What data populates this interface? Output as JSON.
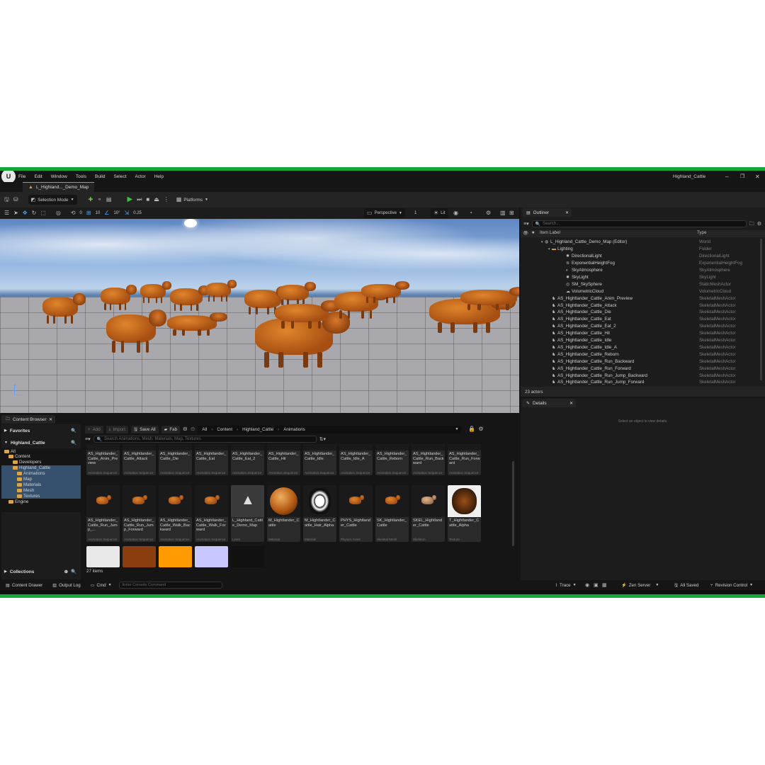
{
  "window": {
    "title": "Highland_Cattle",
    "tab": "L_Highland..._Demo_Map"
  },
  "menu": [
    "File",
    "Edit",
    "Window",
    "Tools",
    "Build",
    "Select",
    "Actor",
    "Help"
  ],
  "toolbar": {
    "mode": "Selection Mode",
    "platforms": "Platforms"
  },
  "viewport": {
    "snap_translate": "10",
    "snap_rotate": "10°",
    "snap_scale": "0.25",
    "snap_unknown": "0",
    "view_mode": "Perspective",
    "lit": "Lit",
    "cam_speed": "1"
  },
  "outliner": {
    "title": "Outliner",
    "search_placeholder": "Search...",
    "col_label": "Item Label",
    "col_type": "Type",
    "count": "23 actors",
    "rows": [
      {
        "label": "L_Highland_Cattle_Demo_Map (Editor)",
        "type": "World",
        "indent": 0,
        "icon": "world"
      },
      {
        "label": "Lighting",
        "type": "Folder",
        "indent": 1,
        "icon": "folder"
      },
      {
        "label": "DirectionalLight",
        "type": "DirectionalLight",
        "indent": 2,
        "icon": "light"
      },
      {
        "label": "ExponentialHeightFog",
        "type": "ExponentialHeightFog",
        "indent": 2,
        "icon": "fog"
      },
      {
        "label": "SkyAtmosphere",
        "type": "SkyAtmosphere",
        "indent": 2,
        "icon": "sky"
      },
      {
        "label": "SkyLight",
        "type": "SkyLight",
        "indent": 2,
        "icon": "light"
      },
      {
        "label": "SM_SkySphere",
        "type": "StaticMeshActor",
        "indent": 2,
        "icon": "mesh"
      },
      {
        "label": "VolumetricCloud",
        "type": "VolumetricCloud",
        "indent": 2,
        "icon": "cloud"
      },
      {
        "label": "AS_Hightlander_Cattle_Anim_Preview",
        "type": "SkeletalMeshActor",
        "indent": 1,
        "icon": "skel"
      },
      {
        "label": "AS_Hightlander_Cattle_Attack",
        "type": "SkeletalMeshActor",
        "indent": 1,
        "icon": "skel"
      },
      {
        "label": "AS_Hightlander_Cattle_Die",
        "type": "SkeletalMeshActor",
        "indent": 1,
        "icon": "skel"
      },
      {
        "label": "AS_Hightlander_Cattle_Eat",
        "type": "SkeletalMeshActor",
        "indent": 1,
        "icon": "skel"
      },
      {
        "label": "AS_Hightlander_Cattle_Eat_2",
        "type": "SkeletalMeshActor",
        "indent": 1,
        "icon": "skel"
      },
      {
        "label": "AS_Hightlander_Cattle_Hit",
        "type": "SkeletalMeshActor",
        "indent": 1,
        "icon": "skel"
      },
      {
        "label": "AS_Hightlander_Cattle_Idle",
        "type": "SkeletalMeshActor",
        "indent": 1,
        "icon": "skel"
      },
      {
        "label": "AS_Hightlander_Cattle_Idle_A",
        "type": "SkeletalMeshActor",
        "indent": 1,
        "icon": "skel"
      },
      {
        "label": "AS_Hightlander_Cattle_Reborn",
        "type": "SkeletalMeshActor",
        "indent": 1,
        "icon": "skel"
      },
      {
        "label": "AS_Hightlander_Cattle_Run_Backward",
        "type": "SkeletalMeshActor",
        "indent": 1,
        "icon": "skel"
      },
      {
        "label": "AS_Hightlander_Cattle_Run_Forward",
        "type": "SkeletalMeshActor",
        "indent": 1,
        "icon": "skel"
      },
      {
        "label": "AS_Hightlander_Cattle_Run_Jump_Backward",
        "type": "SkeletalMeshActor",
        "indent": 1,
        "icon": "skel"
      },
      {
        "label": "AS_Hightlander_Cattle_Run_Jump_Forward",
        "type": "SkeletalMeshActor",
        "indent": 1,
        "icon": "skel"
      }
    ]
  },
  "details": {
    "title": "Details",
    "empty": "Select an object to view details."
  },
  "content_browser": {
    "title": "Content Browser",
    "add": "Add",
    "import": "Import",
    "save_all": "Save All",
    "fab": "Fab",
    "breadcrumb": [
      "All",
      "Content",
      "Highland_Cattle",
      "Animations"
    ],
    "search_placeholder": "Search Animations, Mesh, Materials, Map, Textures",
    "favorites": "Favorites",
    "project": "Highland_Cattle",
    "collections": "Collections",
    "count": "27 items",
    "tree": [
      {
        "label": "All",
        "indent": 0,
        "sel": false
      },
      {
        "label": "Content",
        "indent": 1,
        "sel": false
      },
      {
        "label": "Developers",
        "indent": 2,
        "sel": false
      },
      {
        "label": "Highland_Cattle",
        "indent": 2,
        "sel": true
      },
      {
        "label": "Animations",
        "indent": 3,
        "sel": true
      },
      {
        "label": "Map",
        "indent": 3,
        "sel": true
      },
      {
        "label": "Materials",
        "indent": 3,
        "sel": true
      },
      {
        "label": "Mesh",
        "indent": 3,
        "sel": true
      },
      {
        "label": "Textures",
        "indent": 3,
        "sel": true
      },
      {
        "label": "Engine",
        "indent": 1,
        "sel": false
      }
    ],
    "row1": [
      {
        "name": "AS_Hightlander_Cattle_Anim_Preview",
        "kind": "Animation Sequence"
      },
      {
        "name": "AS_Hightlander_Cattle_Attack",
        "kind": "Animation Sequence"
      },
      {
        "name": "AS_Hightlander_Cattle_Die",
        "kind": "Animation Sequence"
      },
      {
        "name": "AS_Hightlander_Cattle_Eat",
        "kind": "Animation Sequence"
      },
      {
        "name": "AS_Hightlander_Cattle_Eat_2",
        "kind": "Animation Sequence"
      },
      {
        "name": "AS_Hightlander_Cattle_Hit",
        "kind": "Animation Sequence"
      },
      {
        "name": "AS_Hightlander_Cattle_Idle",
        "kind": "Animation Sequence"
      },
      {
        "name": "AS_Hightlander_Cattle_Idle_A",
        "kind": "Animation Sequence"
      },
      {
        "name": "AS_Hightlander_Cattle_Reborn",
        "kind": "Animation Sequence"
      },
      {
        "name": "AS_Hightlander_Cattle_Run_Backward",
        "kind": "Animation Sequence"
      },
      {
        "name": "AS_Hightlander_Cattle_Run_Forward",
        "kind": "Animation Sequence"
      }
    ],
    "row2": [
      {
        "name": "AS_Hightlander_Cattle_Run_Jump_...",
        "kind": "Animation Sequence",
        "thumb": "cow"
      },
      {
        "name": "AS_Hightlander_Cattle_Run_Jump_Forward",
        "kind": "Animation Sequence",
        "thumb": "cow"
      },
      {
        "name": "AS_Hightlander_Cattle_Walk_Backward",
        "kind": "Animation Sequence",
        "thumb": "cow"
      },
      {
        "name": "AS_Hightlander_Cattle_Walk_Forward",
        "kind": "Animation Sequence",
        "thumb": "cow"
      },
      {
        "name": "L_Highland_Cattle_Demo_Map",
        "kind": "Level",
        "thumb": "level"
      },
      {
        "name": "M_Hightlander_Cattle",
        "kind": "Material",
        "thumb": "sphere"
      },
      {
        "name": "M_Hightlander_Cattle_Hair_Alpha",
        "kind": "Material",
        "thumb": "alpha"
      },
      {
        "name": "PHYS_Hightlander_Cattle",
        "kind": "Physics Asset",
        "thumb": "cow"
      },
      {
        "name": "SK_Hightlander_Cattle",
        "kind": "Skeletal Mesh",
        "thumb": "cow"
      },
      {
        "name": "SKEL_Hightlander_Cattle",
        "kind": "Skeleton",
        "thumb": "skel"
      },
      {
        "name": "T_Hightlander_Cattle_Alpha",
        "kind": "Texture",
        "thumb": "tex"
      }
    ]
  },
  "statusbar": {
    "drawer": "Content Drawer",
    "output": "Output Log",
    "cmd": "Cmd",
    "console_placeholder": "Enter Console Command",
    "trace": "Trace",
    "zen": "Zen Server",
    "saved": "All Saved",
    "revision": "Revision Control"
  },
  "colors": {
    "accent_green": "#13a538",
    "selection": "#35516d",
    "play": "#3fbf3f"
  }
}
